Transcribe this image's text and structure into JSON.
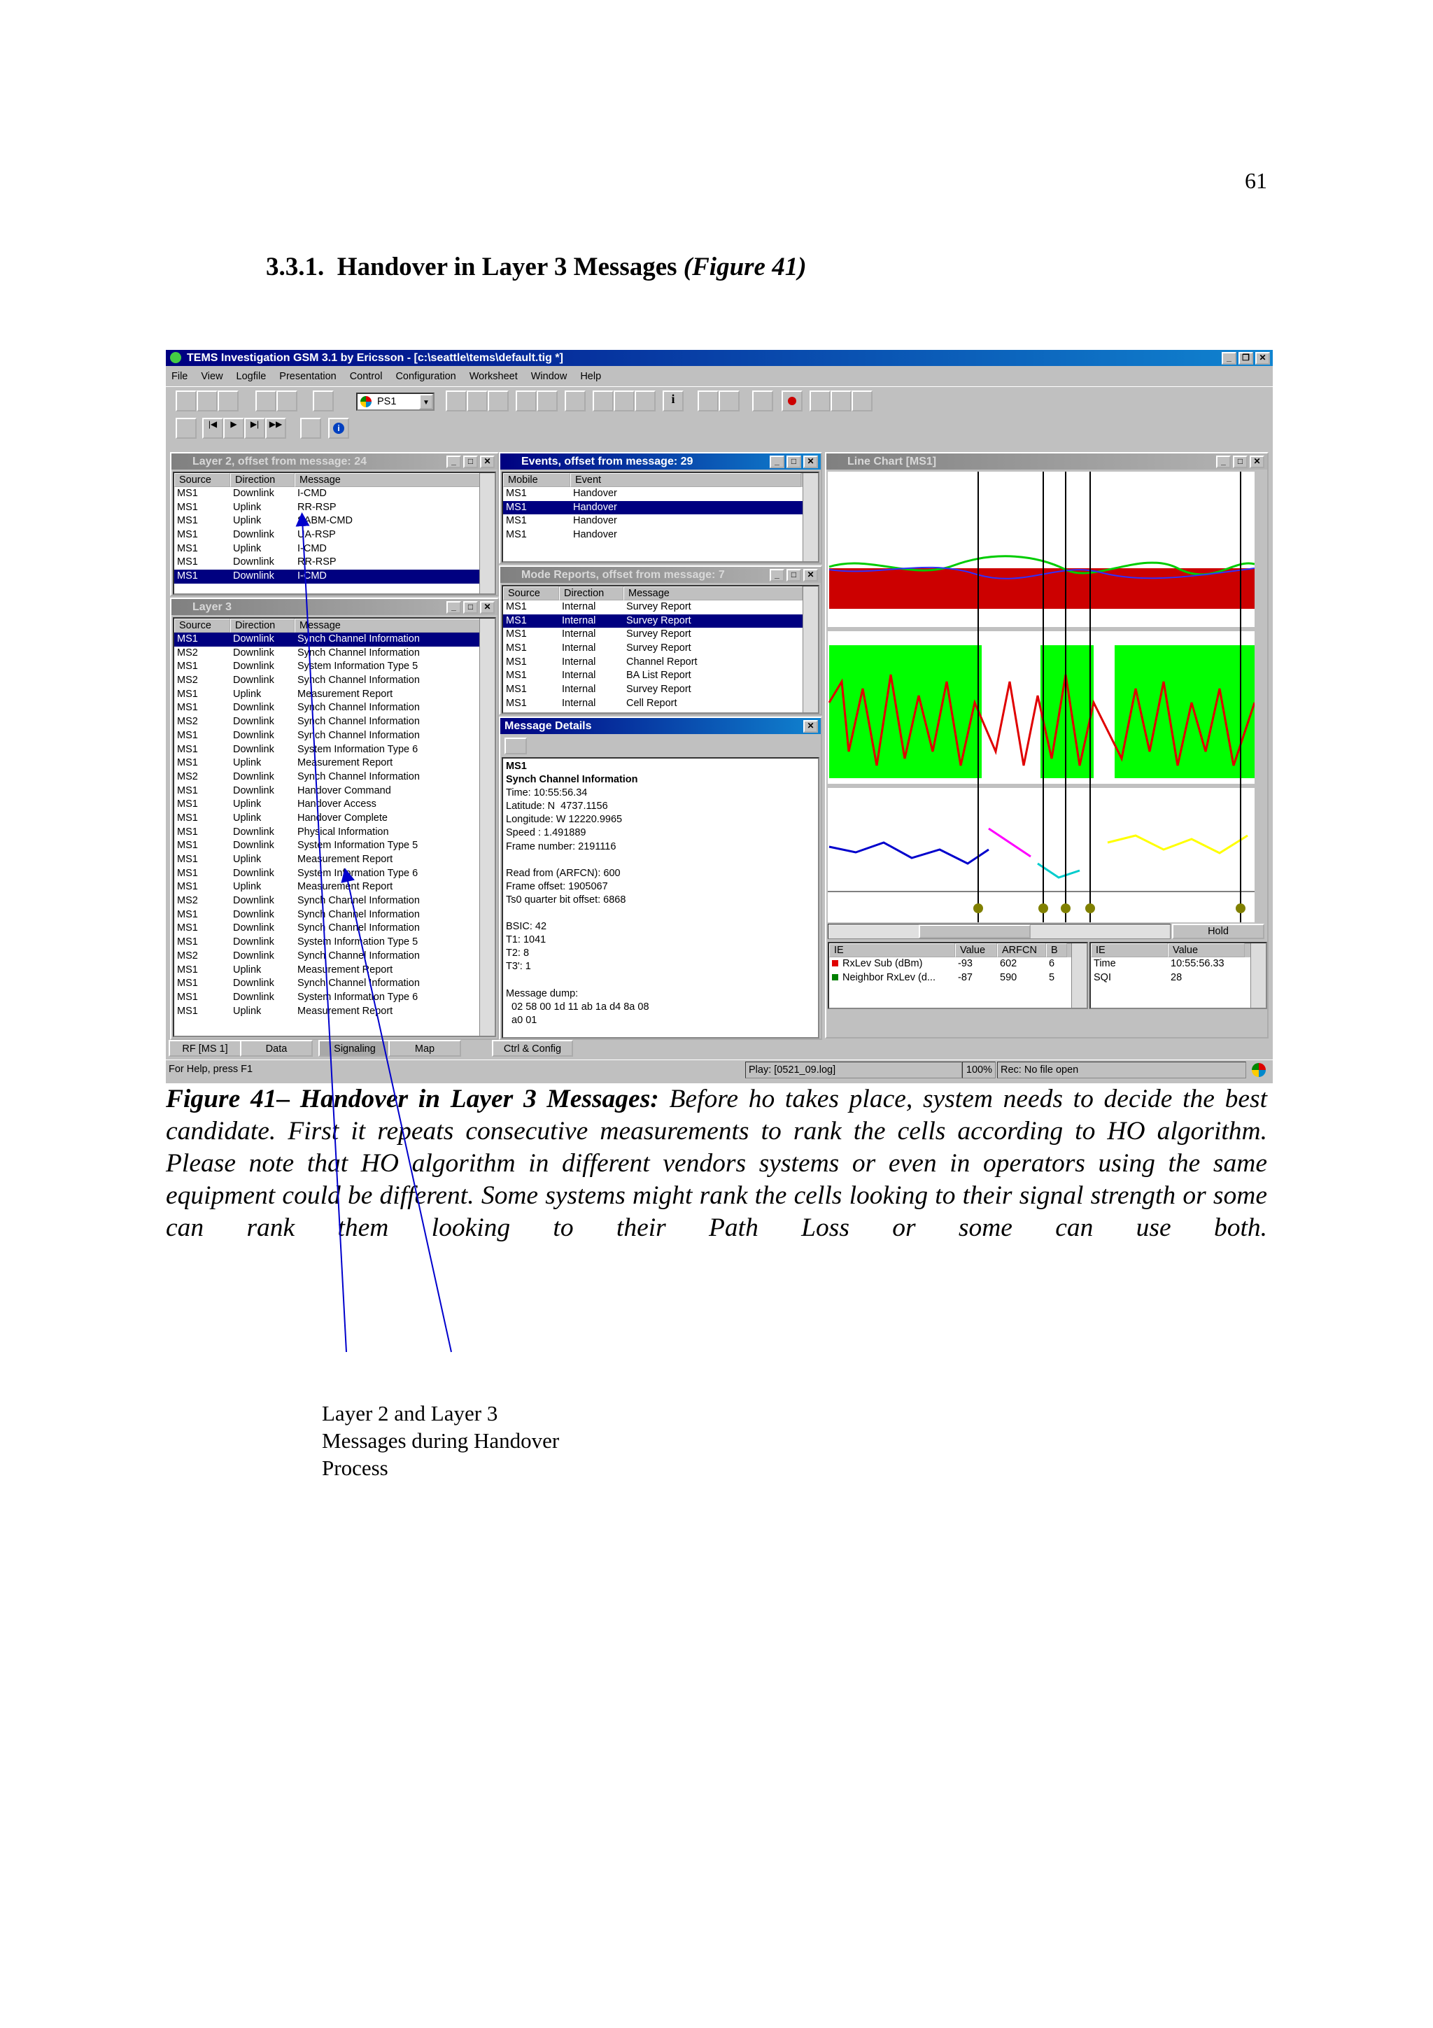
{
  "page_number": "61",
  "section": {
    "number": "3.3.1.",
    "title": "Handover in Layer 3 Messages",
    "figref": "(Figure 41)"
  },
  "app": {
    "title": "TEMS Investigation GSM 3.1 by Ericsson - [c:\\seattle\\tems\\default.tig *]",
    "menu": [
      "File",
      "View",
      "Logfile",
      "Presentation",
      "Control",
      "Configuration",
      "Worksheet",
      "Window",
      "Help"
    ],
    "ps_select": "PS1",
    "layer2": {
      "title": "Layer 2, offset from message: 24",
      "cols": [
        "Source",
        "Direction",
        "Message"
      ],
      "rows": [
        [
          "MS1",
          "Downlink",
          "I-CMD"
        ],
        [
          "MS1",
          "Uplink",
          "RR-RSP"
        ],
        [
          "MS1",
          "Uplink",
          "SABM-CMD"
        ],
        [
          "MS1",
          "Downlink",
          "UA-RSP"
        ],
        [
          "MS1",
          "Uplink",
          "I-CMD"
        ],
        [
          "MS1",
          "Downlink",
          "RR-RSP"
        ],
        [
          "MS1",
          "Downlink",
          "I-CMD"
        ]
      ],
      "selected": 6
    },
    "layer3": {
      "title": "Layer 3",
      "cols": [
        "Source",
        "Direction",
        "Message"
      ],
      "rows": [
        [
          "MS1",
          "Downlink",
          "Synch Channel Information"
        ],
        [
          "MS2",
          "Downlink",
          "Synch Channel Information"
        ],
        [
          "MS1",
          "Downlink",
          "System Information Type 5"
        ],
        [
          "MS2",
          "Downlink",
          "Synch Channel Information"
        ],
        [
          "MS1",
          "Uplink",
          "Measurement Report"
        ],
        [
          "MS1",
          "Downlink",
          "Synch Channel Information"
        ],
        [
          "MS2",
          "Downlink",
          "Synch Channel Information"
        ],
        [
          "MS1",
          "Downlink",
          "Synch Channel Information"
        ],
        [
          "MS1",
          "Downlink",
          "System Information Type 6"
        ],
        [
          "MS1",
          "Uplink",
          "Measurement Report"
        ],
        [
          "MS2",
          "Downlink",
          "Synch Channel Information"
        ],
        [
          "MS1",
          "Downlink",
          "Handover Command"
        ],
        [
          "MS1",
          "Uplink",
          "Handover Access"
        ],
        [
          "MS1",
          "Uplink",
          "Handover Complete"
        ],
        [
          "MS1",
          "Downlink",
          "Physical Information"
        ],
        [
          "MS1",
          "Downlink",
          "System Information Type 5"
        ],
        [
          "MS1",
          "Uplink",
          "Measurement Report"
        ],
        [
          "MS1",
          "Downlink",
          "System Information Type 6"
        ],
        [
          "MS1",
          "Uplink",
          "Measurement Report"
        ],
        [
          "MS2",
          "Downlink",
          "Synch Channel Information"
        ],
        [
          "MS1",
          "Downlink",
          "Synch Channel Information"
        ],
        [
          "MS1",
          "Downlink",
          "Synch Channel Information"
        ],
        [
          "MS1",
          "Downlink",
          "System Information Type 5"
        ],
        [
          "MS2",
          "Downlink",
          "Synch Channel Information"
        ],
        [
          "MS1",
          "Uplink",
          "Measurement Report"
        ],
        [
          "MS1",
          "Downlink",
          "Synch Channel Information"
        ],
        [
          "MS1",
          "Downlink",
          "System Information Type 6"
        ],
        [
          "MS1",
          "Uplink",
          "Measurement Report"
        ]
      ],
      "selected": 0
    },
    "events": {
      "title": "Events, offset from message: 29",
      "cols": [
        "Mobile",
        "Event"
      ],
      "rows": [
        [
          "MS1",
          "Handover"
        ],
        [
          "MS1",
          "Handover"
        ],
        [
          "MS1",
          "Handover"
        ],
        [
          "MS1",
          "Handover"
        ]
      ],
      "selected": 1
    },
    "mode": {
      "title": "Mode Reports, offset from message: 7",
      "cols": [
        "Source",
        "Direction",
        "Message"
      ],
      "rows": [
        [
          "MS1",
          "Internal",
          "Survey Report"
        ],
        [
          "MS1",
          "Internal",
          "Survey Report"
        ],
        [
          "MS1",
          "Internal",
          "Survey Report"
        ],
        [
          "MS1",
          "Internal",
          "Survey Report"
        ],
        [
          "MS1",
          "Internal",
          "Channel Report"
        ],
        [
          "MS1",
          "Internal",
          "BA List Report"
        ],
        [
          "MS1",
          "Internal",
          "Survey Report"
        ],
        [
          "MS1",
          "Internal",
          "Cell Report"
        ]
      ],
      "selected": 1
    },
    "details": {
      "title": "Message Details",
      "lines": [
        "MS1",
        "Synch Channel Information",
        "Time: 10:55:56.34",
        "Latitude: N  4737.1156",
        "Longitude: W 12220.9965",
        "Speed : 1.491889",
        "Frame number: 2191116",
        "",
        "Read from (ARFCN): 600",
        "Frame offset: 1905067",
        "Ts0 quarter bit offset: 6868",
        "",
        "BSIC: 42",
        "T1: 1041",
        "T2: 8",
        "T3': 1",
        "",
        "Message dump:",
        "  02 58 00 1d 11 ab 1a d4 8a 08",
        "  a0 01"
      ]
    },
    "linechart": {
      "title": "Line Chart [MS1]",
      "hold": "Hold"
    },
    "ie1": {
      "cols": [
        "IE",
        "Value",
        "ARFCN",
        "B"
      ],
      "rows": [
        [
          "RxLev Sub (dBm)",
          "-93",
          "602",
          "6"
        ],
        [
          "Neighbor RxLev (d...",
          "-87",
          "590",
          "5"
        ]
      ],
      "colors": [
        "#e00000",
        "#008000"
      ]
    },
    "ie2": {
      "cols": [
        "IE",
        "Value"
      ],
      "rows": [
        [
          "Time",
          "10:55:56.33"
        ],
        [
          "SQI",
          "28"
        ]
      ]
    },
    "tabs": [
      "RF [MS 1]",
      "Data",
      "Signaling",
      "Map"
    ],
    "tab2": "Ctrl & Config",
    "status": {
      "help": "For Help, press F1",
      "play": "Play: [0521_09.log]",
      "pct": "100%",
      "rec": "Rec: No file open"
    }
  },
  "caption": {
    "label": "Figure 41– Handover in Layer 3 Messages:",
    "text": " Before ho takes place, system needs to decide the best candidate. First it repeats consecutive measurements to rank the cells according to HO algorithm. Please note that HO algorithm in different vendors systems or even in operators using the same equipment could be different. Some systems might rank the cells looking to their signal strength or some can rank them looking to their Path Loss or some can use both."
  },
  "annotation": [
    "Layer 2 and Layer 3",
    "Messages during Handover",
    "Process"
  ]
}
